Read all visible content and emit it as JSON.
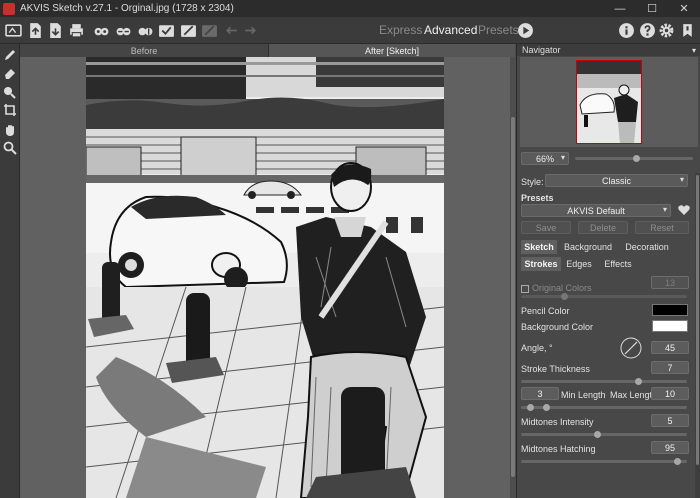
{
  "window": {
    "title": "AKVIS Sketch v.27.1 - Orginal.jpg (1728 x 2304)",
    "controls": {
      "minimize": "—",
      "maximize": "☐",
      "close": "✕"
    }
  },
  "toolbar": {
    "modes": {
      "express": "Express",
      "advanced": "Advanced",
      "presets": "Presets"
    },
    "icons": [
      "home-icon",
      "open-icon",
      "save-icon",
      "print-icon",
      "batch-icon",
      "export-icon",
      "canvas-icon",
      "settings-icon",
      "brush-icon",
      "plugin-icon",
      "undo-icon",
      "redo-icon",
      "run-icon",
      "info-icon",
      "help-icon",
      "gear-icon",
      "notifications-icon"
    ]
  },
  "tabs": {
    "before": "Before",
    "after": "After [Sketch]"
  },
  "navigator": {
    "title": "Navigator",
    "zoom": "66%",
    "zoom_fraction": 0.52
  },
  "style": {
    "label": "Style:",
    "value": "Classic"
  },
  "presets": {
    "label": "Presets",
    "value": "AKVIS Default",
    "save": "Save",
    "delete": "Delete",
    "reset": "Reset"
  },
  "main_tabs": [
    "Sketch",
    "Background",
    "Decoration"
  ],
  "sub_tabs": [
    "Strokes",
    "Edges",
    "Effects"
  ],
  "strokes": {
    "original_colors": {
      "label": "Original Colors",
      "value": "13",
      "checked": false,
      "fraction": 0.25
    },
    "pencil_color": {
      "label": "Pencil Color",
      "color": "#000000"
    },
    "background_color": {
      "label": "Background Color",
      "color": "#ffffff"
    },
    "angle": {
      "label": "Angle, °",
      "value": "45"
    },
    "stroke_thickness": {
      "label": "Stroke Thickness",
      "value": "7",
      "fraction": 0.72
    },
    "length": {
      "min": "3",
      "min_label": "Min Length",
      "max_label": "Max Length",
      "max": "10"
    },
    "midtones_intensity": {
      "label": "Midtones Intensity",
      "value": "5",
      "fraction": 0.46
    },
    "midtones_hatching": {
      "label": "Midtones Hatching",
      "value": "95",
      "fraction": 0.96
    }
  },
  "colors": {
    "panel": "#484848",
    "accent": "#c9302c"
  }
}
